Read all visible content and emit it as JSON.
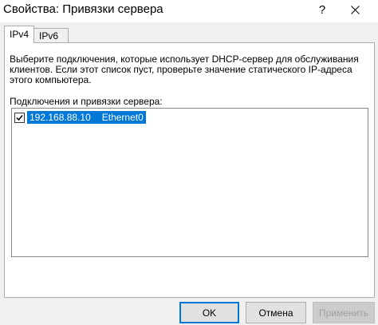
{
  "window": {
    "title": "Свойства: Привязки сервера",
    "help_label": "?"
  },
  "tabs": [
    {
      "label": "IPv4",
      "selected": true
    },
    {
      "label": "IPv6",
      "selected": false
    }
  ],
  "panel": {
    "description": "Выберите подключения, которые использует DHCP-сервер для обслуживания клиентов. Если этот список пуст, проверьте значение статического IP-адреса этого компьютера.",
    "list_label": "Подключения и привязки сервера:",
    "connections": [
      {
        "ip": "192.168.88.10",
        "interface": "Ethernet0",
        "checked": true,
        "selected": true
      }
    ]
  },
  "buttons": {
    "ok": "OK",
    "cancel": "Отмена",
    "apply": "Применить"
  },
  "colors": {
    "selection": "#0078d7",
    "dialog_bg": "#f0f0f0"
  }
}
